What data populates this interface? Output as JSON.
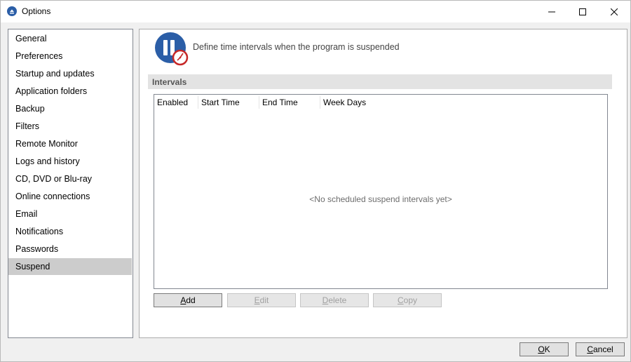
{
  "window": {
    "title": "Options"
  },
  "nav": {
    "items": [
      {
        "label": "General"
      },
      {
        "label": "Preferences"
      },
      {
        "label": "Startup and updates"
      },
      {
        "label": "Application folders"
      },
      {
        "label": "Backup"
      },
      {
        "label": "Filters"
      },
      {
        "label": "Remote Monitor"
      },
      {
        "label": "Logs and history"
      },
      {
        "label": "CD, DVD or Blu-ray"
      },
      {
        "label": "Online connections"
      },
      {
        "label": "Email"
      },
      {
        "label": "Notifications"
      },
      {
        "label": "Passwords"
      },
      {
        "label": "Suspend"
      }
    ],
    "selected": "Suspend"
  },
  "page": {
    "description": "Define time intervals when the program is suspended",
    "section_title": "Intervals",
    "table": {
      "columns": [
        "Enabled",
        "Start Time",
        "End Time",
        "Week Days"
      ],
      "rows": [],
      "empty_message": "<No scheduled suspend intervals yet>"
    },
    "actions": {
      "add": {
        "first": "A",
        "rest": "dd",
        "enabled": true
      },
      "edit": {
        "first": "E",
        "rest": "dit",
        "enabled": false
      },
      "delete": {
        "first": "D",
        "rest": "elete",
        "enabled": false
      },
      "copy": {
        "first": "C",
        "rest": "opy",
        "enabled": false
      }
    }
  },
  "footer": {
    "ok": {
      "first": "O",
      "rest": "K"
    },
    "cancel": {
      "first": "C",
      "rest": "ancel"
    }
  },
  "colors": {
    "selected_nav": "#cccccc",
    "icon_blue": "#2b5ea7",
    "icon_red": "#c62828"
  }
}
